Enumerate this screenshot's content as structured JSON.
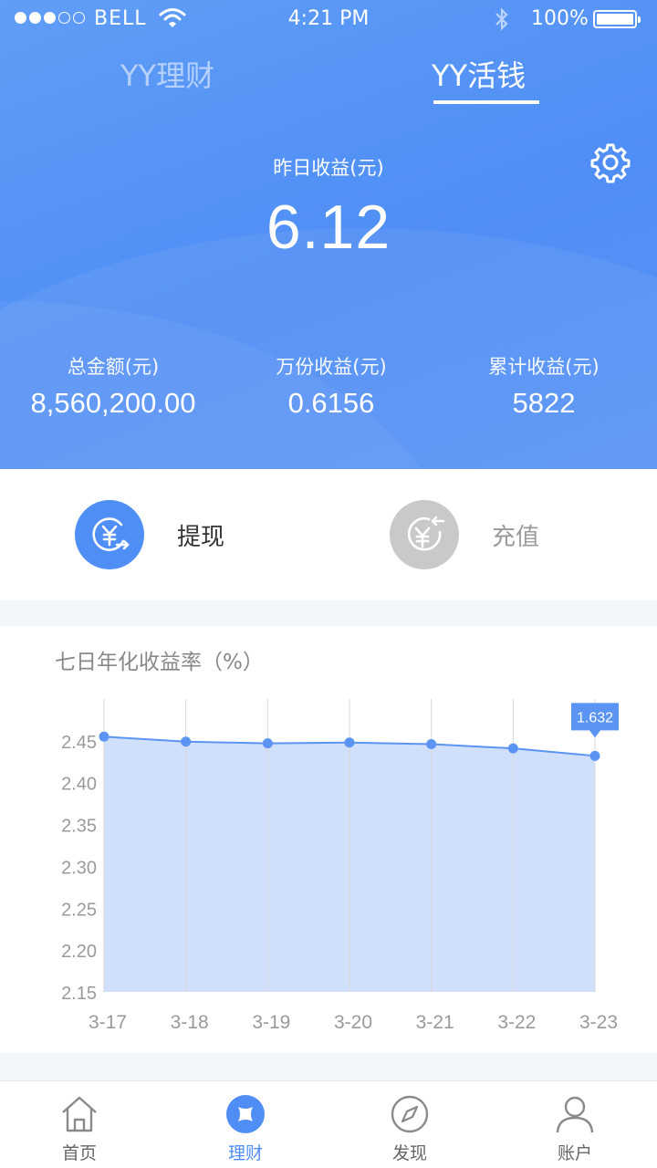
{
  "status_bar": {
    "carrier": "BELL",
    "time": "4:21 PM",
    "battery": "100%"
  },
  "tabs": [
    {
      "label": "YY理财",
      "active": false
    },
    {
      "label": "YY活钱",
      "active": true
    }
  ],
  "header": {
    "yesterday_label": "昨日收益(元)",
    "yesterday_value": "6.12",
    "stats": [
      {
        "label": "总金额(元)",
        "value": "8,560,200.00"
      },
      {
        "label": "万份收益(元)",
        "value": "0.6156"
      },
      {
        "label": "累计收益(元)",
        "value": "5822"
      }
    ]
  },
  "actions": {
    "withdraw": {
      "label": "提现",
      "icon": "yen-out-icon"
    },
    "recharge": {
      "label": "充值",
      "icon": "yen-in-icon"
    }
  },
  "chart_section": {
    "title": "七日年化收益率（%）"
  },
  "chart_data": {
    "type": "area",
    "title": "七日年化收益率（%）",
    "categories": [
      "3-17",
      "3-18",
      "3-19",
      "3-20",
      "3-21",
      "3-22",
      "3-23"
    ],
    "values": [
      2.455,
      2.449,
      2.447,
      2.448,
      2.446,
      2.441,
      2.432
    ],
    "ylim": [
      2.15,
      2.5
    ],
    "yticks": [
      "2.45",
      "2.40",
      "2.35",
      "2.30",
      "2.25",
      "2.20",
      "2.15"
    ],
    "ytick_values": [
      2.45,
      2.4,
      2.35,
      2.3,
      2.25,
      2.2,
      2.15
    ],
    "tooltip": {
      "category": "3-23",
      "text": "1.632"
    },
    "colors": {
      "line": "#5b94f2",
      "fill": "#d0e0fb",
      "grid": "#d9d9d9",
      "tooltip": "#5b94f2"
    },
    "grid": "vertical"
  },
  "tabbar": [
    {
      "label": "首页",
      "icon": "home-icon",
      "active": false
    },
    {
      "label": "理财",
      "icon": "finance-icon",
      "active": true
    },
    {
      "label": "发现",
      "icon": "compass-icon",
      "active": false
    },
    {
      "label": "账户",
      "icon": "user-icon",
      "active": false
    }
  ],
  "colors": {
    "accent": "#4f8ef5",
    "inactive_icon": "#c9c9c9"
  }
}
